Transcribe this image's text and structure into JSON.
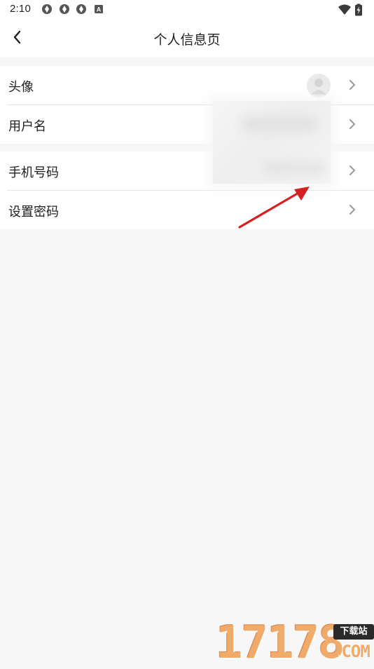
{
  "status_bar": {
    "time": "2:10",
    "left_icons": [
      "notification-app-icon",
      "notification-app-icon",
      "notification-app-icon",
      "notification-a-icon"
    ],
    "notification_letter": "A",
    "right_icons": [
      "wifi-icon",
      "battery-charging-icon"
    ]
  },
  "header": {
    "title": "个人信息页",
    "back_icon": "chevron-left-icon"
  },
  "settings": {
    "group1": [
      {
        "label": "头像"
      },
      {
        "label": "用户名"
      }
    ],
    "group2": [
      {
        "label": "手机号码"
      },
      {
        "label": "设置密码"
      }
    ]
  },
  "watermark": {
    "digits": "17178",
    "badge": "下载站",
    "suffix": ".COM"
  },
  "colors": {
    "page_background": "#f7f7f7",
    "card_background": "#ffffff",
    "divider": "#e4e4e4",
    "chevron": "#9a9a9a",
    "annotation_arrow": "#d42020",
    "watermark_orange": "#f0ab6b"
  }
}
